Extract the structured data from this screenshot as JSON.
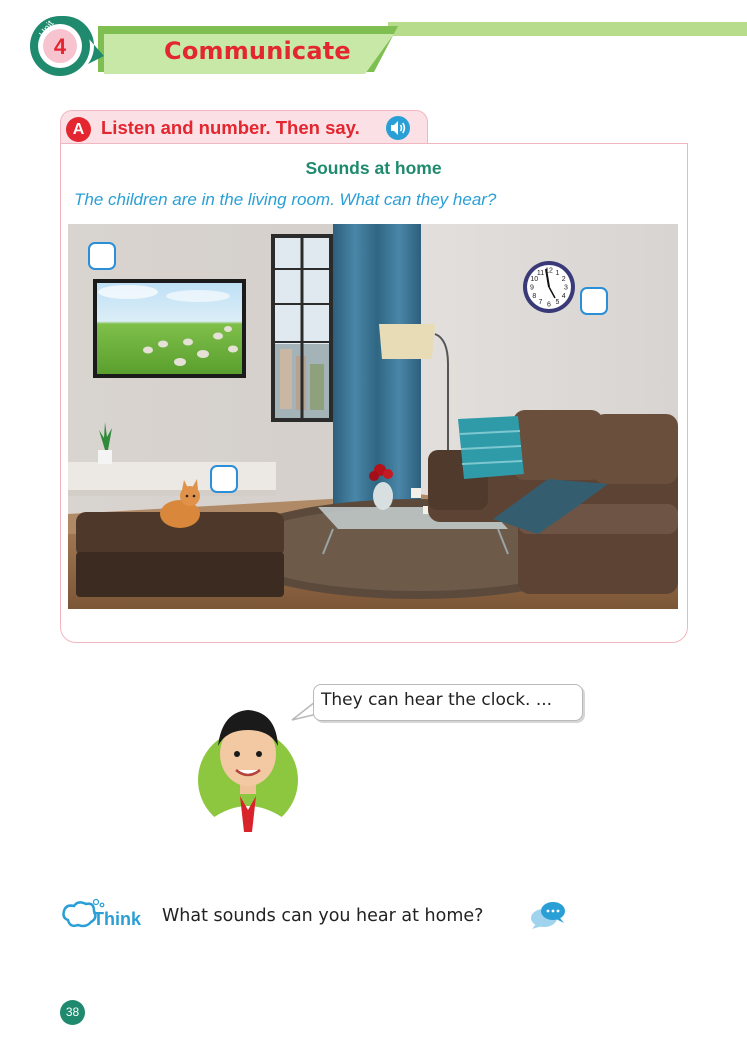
{
  "header": {
    "unit_label": "Unit",
    "unit_number": "4",
    "title": "Communicate"
  },
  "section_a": {
    "letter": "A",
    "instruction": "Listen and number. Then say.",
    "audio_icon": "speaker-icon",
    "title": "Sounds at home",
    "subtitle": "The children are in the living room. What can they hear?"
  },
  "illustration": {
    "clock_numbers": [
      "12",
      "1",
      "2",
      "3",
      "4",
      "5",
      "6",
      "7",
      "8",
      "9",
      "10",
      "11"
    ]
  },
  "dialogue": {
    "speech": "They can hear the clock. ..."
  },
  "think": {
    "label": "Think",
    "question": "What sounds can you hear at home?",
    "chat_icon": "chat-bubble-icon"
  },
  "page_number": "38",
  "colors": {
    "accent_red": "#e3262f",
    "accent_green": "#1f8a6e",
    "accent_blue": "#2a9fd6",
    "banner_green": "#c8e8a8"
  }
}
